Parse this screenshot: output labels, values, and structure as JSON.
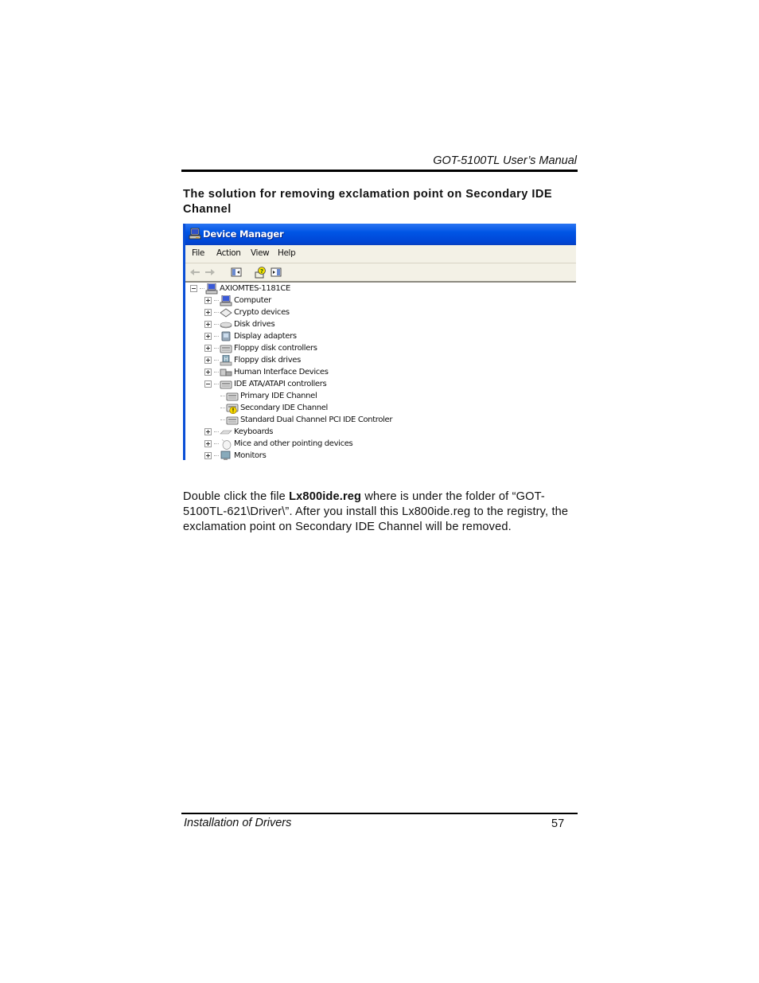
{
  "header": {
    "running_title": "GOT-5100TL User’s Manual"
  },
  "section": {
    "title": "The solution for removing exclamation point on Secondary IDE Channel"
  },
  "screenshot": {
    "window_title": "Device Manager",
    "title_icon": "computer-icon",
    "menu": [
      "File",
      "Action",
      "View",
      "Help"
    ],
    "toolbar": [
      {
        "name": "back-arrow-icon",
        "enabled": false
      },
      {
        "name": "forward-arrow-icon",
        "enabled": false
      },
      {
        "name": "show-hide-console-tree-icon",
        "enabled": true
      },
      {
        "name": "help-icon",
        "enabled": true
      },
      {
        "name": "show-hide-action-pane-icon",
        "enabled": true
      }
    ],
    "colors": {
      "titlebar": "#0055e5",
      "menubar": "#f3f1e6",
      "warning": "#f5d800"
    },
    "tree": {
      "root": {
        "label": "AXIOMTES-1181CE",
        "icon": "computer-icon",
        "expanded": true
      },
      "items": [
        {
          "label": "Computer",
          "icon": "computer-icon",
          "expanded": false
        },
        {
          "label": "Crypto devices",
          "icon": "crypto-icon",
          "expanded": false
        },
        {
          "label": "Disk drives",
          "icon": "disk-drive-icon",
          "expanded": false
        },
        {
          "label": "Display adapters",
          "icon": "display-adapter-icon",
          "expanded": false
        },
        {
          "label": "Floppy disk controllers",
          "icon": "controller-icon",
          "expanded": false
        },
        {
          "label": "Floppy disk drives",
          "icon": "floppy-drive-icon",
          "expanded": false
        },
        {
          "label": "Human Interface Devices",
          "icon": "hid-icon",
          "expanded": false
        },
        {
          "label": "IDE ATA/ATAPI controllers",
          "icon": "controller-icon",
          "expanded": true,
          "children": [
            {
              "label": "Primary IDE Channel",
              "icon": "controller-icon",
              "warning": false
            },
            {
              "label": "Secondary IDE Channel",
              "icon": "controller-warning-icon",
              "warning": true
            },
            {
              "label": "Standard Dual Channel PCI IDE Controler",
              "icon": "controller-icon",
              "warning": false
            }
          ]
        },
        {
          "label": "Keyboards",
          "icon": "keyboard-icon",
          "expanded": false
        },
        {
          "label": "Mice and other pointing devices",
          "icon": "mouse-icon",
          "expanded": false
        },
        {
          "label": "Monitors",
          "icon": "monitor-icon",
          "expanded": false
        }
      ]
    }
  },
  "body": {
    "p1_before": "Double click the file ",
    "p1_bold": "Lx800ide.reg",
    "p1_after": " where is under the folder of “GOT-5100TL-621\\Driver\\”. After you install this Lx800ide.reg to the registry, the exclamation point on Secondary IDE Channel will be removed."
  },
  "footer": {
    "section_name": "Installation of Drivers",
    "page_number": "57"
  }
}
